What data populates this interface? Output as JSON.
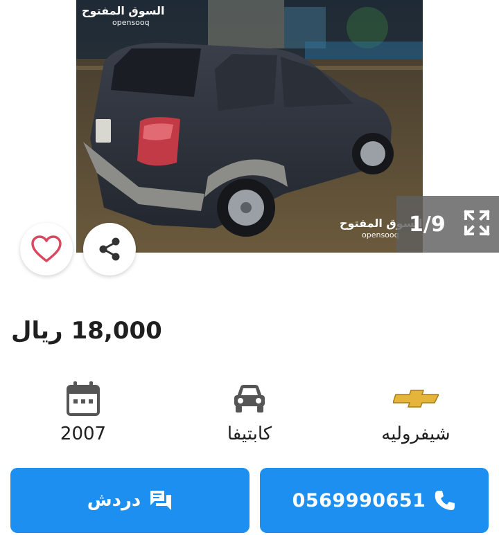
{
  "gallery": {
    "watermark_top_ar": "السوق المفتوح",
    "watermark_top_en": "opensooq",
    "watermark_bottom_ar": "السوق المفتوح",
    "watermark_bottom_en": "opensooq",
    "counter": "1/9",
    "prev_icon": "chevron-left-icon",
    "next_icon": "chevron-right-icon",
    "expand_icon": "expand-icon"
  },
  "actions": {
    "favorite_icon": "heart-icon",
    "share_icon": "share-icon"
  },
  "listing": {
    "price": "18,000",
    "currency": "ريال"
  },
  "attributes": [
    {
      "icon": "calendar-icon",
      "label": "2007"
    },
    {
      "icon": "car-icon",
      "label": "كابتيفا"
    },
    {
      "icon": "chevrolet-logo-icon",
      "label": "شيفروليه"
    }
  ],
  "contact": {
    "chat_label": "دردش",
    "phone_label": "0569990651"
  },
  "colors": {
    "accent": "#1d8ff0",
    "favorite": "#d9485f",
    "chevrolet_gold": "#e4b53a"
  }
}
